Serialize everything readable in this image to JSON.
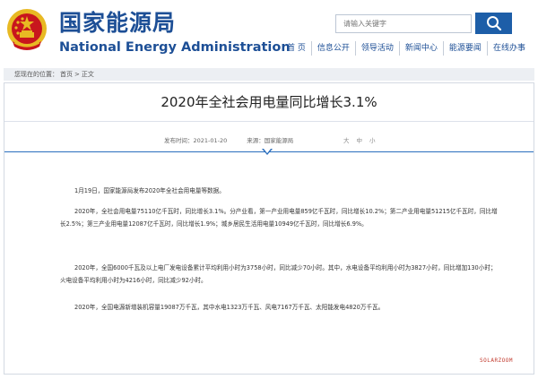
{
  "header": {
    "site_name_cn": "国家能源局",
    "site_name_en": "National Energy Administration",
    "search_placeholder": "请输入关键字",
    "nav": [
      "首 页",
      "信息公开",
      "领导活动",
      "新闻中心",
      "能源要闻",
      "在线办事"
    ]
  },
  "breadcrumb": {
    "prefix": "您现在的位置：",
    "home": "首页",
    "sep1": ">",
    "current": "正文"
  },
  "article": {
    "title": "2020年全社会用电量同比增长3.1%",
    "publish_time": "发布时间：2021-01-20",
    "source": "来源：国家能源局",
    "font_sizes": [
      "大",
      "中",
      "小"
    ],
    "paragraphs": [
      "1月19日，国家能源局发布2020年全社会用电量等数据。",
      "2020年，全社会用电量75110亿千瓦时，同比增长3.1%。分产业看，第一产业用电量859亿千瓦时，同比增长10.2%；第二产业用电量51215亿千瓦时，同比增长2.5%；第三产业用电量12087亿千瓦时，同比增长1.9%；城乡居民生活用电量10949亿千瓦时，同比增长6.9%。",
      "2020年，全国6000千瓦及以上电厂发电设备累计平均利用小时为3758小时，同比减少70小时。其中，水电设备平均利用小时为3827小时，同比增加130小时；火电设备平均利用小时为4216小时，同比减少92小时。",
      "2020年，全国电源新增装机容量19087万千瓦，其中水电1323万千瓦、风电7167万千瓦、太阳能发电4820万千瓦。"
    ]
  },
  "watermark": "SOLARZOOM",
  "colors": {
    "brand_blue": "#1d4f96",
    "button_blue": "#1d5ea8",
    "emblem_red": "#c8161d",
    "emblem_gold": "#e8b923"
  }
}
